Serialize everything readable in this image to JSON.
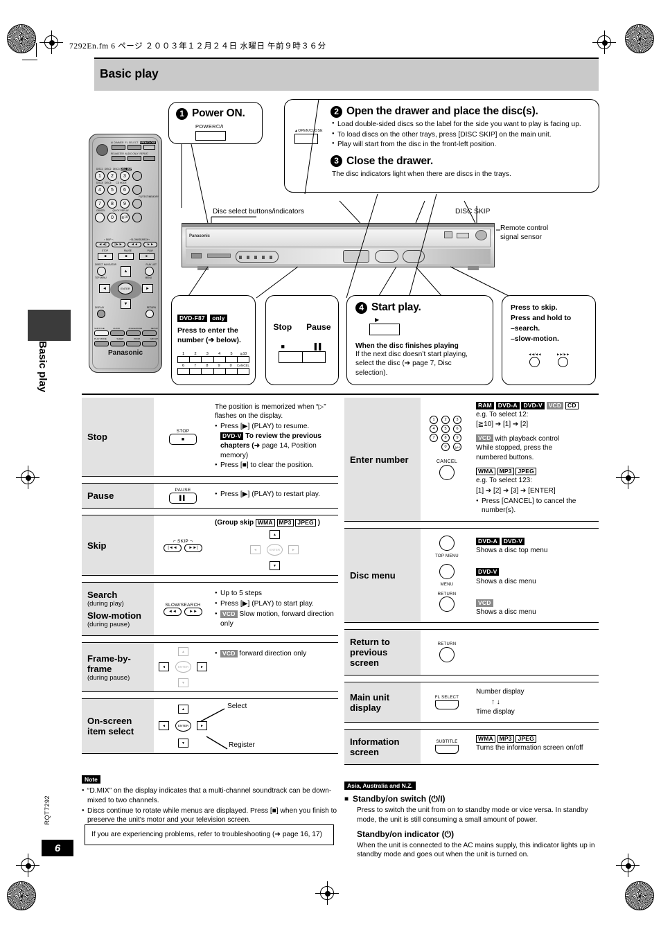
{
  "meta": {
    "fm_header": "7292En.fm  6 ページ  ２００３年１２月２４日  水曜日  午前９時３６分",
    "page_number": "6",
    "doc_code": "RQT7292",
    "spine_label": "Basic play"
  },
  "title": "Basic play",
  "steps": {
    "step1": {
      "num": "1",
      "heading": "Power ON.",
      "button_caption": "POWER⏻/I"
    },
    "step2": {
      "num": "2",
      "heading": "Open the drawer and place the disc(s).",
      "button_caption": "▲OPEN/CLOSE",
      "bullets": [
        "Load double-sided discs so the label for the side you want to play is facing up.",
        "To load discs on the other trays, press [DISC SKIP] on the main unit.",
        "Play will start from the disc in the front-left position."
      ]
    },
    "step3": {
      "num": "3",
      "heading": "Close the drawer.",
      "text": "The disc indicators light when there are discs in the trays."
    },
    "step4": {
      "num": "4",
      "heading": "Start play.",
      "play_glyph": "▶",
      "subheading": "When the disc finishes playing",
      "text": "If the next disc doesn’t start playing, select the disc (➔ page 7, Disc selection)."
    }
  },
  "unit_labels": {
    "disc_select": "Disc select buttons/indicators",
    "disc_skip": "DISC SKIP",
    "remote_sensor": "Remote control\nsignal sensor",
    "brand": "Panasonic"
  },
  "callouts": {
    "numpad": {
      "badge": "DVD-F87",
      "badge_suffix": "only",
      "line1": "Press to enter the",
      "line2": "number (➔ below).",
      "keys_top": [
        "1",
        "2",
        "3",
        "4",
        "5",
        "≧10"
      ],
      "keys_bottom": [
        "6",
        "7",
        "8",
        "9",
        "0",
        "CANCEL"
      ]
    },
    "stoppause": {
      "stop": "Stop",
      "pause": "Pause"
    },
    "skipsearch": {
      "line1": "Press to skip.",
      "line2": "Press and hold to",
      "line3": "–search.",
      "line4": "–slow-motion."
    }
  },
  "remote": {
    "brand": "Panasonic",
    "row_top": [
      "AI DIMMER",
      "FL SELECT",
      "OPEN/CLOSE"
    ],
    "row_top2": [
      "RE-MASTER",
      "AUDIO ONLY",
      "REPEAT"
    ],
    "disc_labels": [
      "DISC1",
      "DISC2",
      "DISC3",
      "DISC4",
      "DISC5",
      "DISC SKIP",
      "CD MODE",
      "FQ/TEXT/MEMORY",
      "QUICK REPLAY"
    ],
    "numbers": [
      "1",
      "2",
      "3",
      "4",
      "5",
      "6",
      "7",
      "8",
      "9",
      "0"
    ],
    "cancel": "CANCEL",
    "ge10": "≧10",
    "skip": "SKIP",
    "slowsearch": "SLOW/SEARCH",
    "transport": [
      "STOP",
      "PAUSE",
      "PLAY"
    ],
    "nav": [
      "DIRECT NAVIGATOR",
      "PLAY LIST",
      "TOP MENU",
      "MENU",
      "ENTER",
      "DISPLAY",
      "RETURN"
    ],
    "bottom_rows": [
      [
        "SUBTITLE",
        "AUDIO",
        "ANGLE/PAGE",
        "SETUP"
      ],
      [
        "PLAY MODE",
        "SLEEP",
        "ZOOM",
        "GROUP"
      ]
    ]
  },
  "left_table": [
    {
      "label": "Stop",
      "sub": "",
      "key_caption": "STOP",
      "key_glyph": "■",
      "key_type": "rect",
      "desc_html": "The position is memorized when “▷” flashes on the display.",
      "bullets": [
        "Press [▶] (PLAY) to resume. <b>DVD-V</b> <b>To review the previous chapters (➔ page 14, Position memory)</b>",
        "Press [■] to clear the position."
      ]
    },
    {
      "label": "Pause",
      "sub": "",
      "key_caption": "PAUSE",
      "key_glyph": "▐▐",
      "key_type": "rect",
      "desc_html": "",
      "bullets": [
        "Press [▶] (PLAY) to restart play."
      ]
    },
    {
      "label": "Skip",
      "sub": "",
      "key_caption": "SKIP",
      "key_glyph": "",
      "key_type": "skippair",
      "desc_html": "(Group skip WMA MP3 JPEG )",
      "bullets": []
    },
    {
      "label": "Search",
      "sub": "(during play)",
      "label2": "Slow-motion",
      "sub2": "(during pause)",
      "key_caption": "SLOW/SEARCH",
      "key_glyph": "",
      "key_type": "searchpair",
      "desc_html": "",
      "bullets": [
        "Up to 5 steps",
        "Press [▶] (PLAY) to start play.",
        "VCD Slow motion, forward direction only"
      ]
    },
    {
      "label": "Frame-by-frame",
      "sub": "(during pause)",
      "key_caption": "",
      "key_glyph": "",
      "key_type": "dpad-lr",
      "desc_html": "",
      "bullets": [
        "VCD forward direction only"
      ]
    },
    {
      "label": "On-screen item select",
      "sub": "",
      "key_caption": "",
      "key_glyph": "",
      "key_type": "dpad-full",
      "desc_html": "",
      "annotations": {
        "select": "Select",
        "register": "Register"
      },
      "bullets": []
    }
  ],
  "right_table": [
    {
      "label": "Enter number",
      "key_type": "numpad-cancel",
      "cancel_caption": "CANCEL",
      "blocks": [
        {
          "badges": [
            {
              "t": "RAM",
              "s": "solid"
            },
            {
              "t": "DVD-A",
              "s": "solid"
            },
            {
              "t": "DVD-V",
              "s": "solid"
            },
            {
              "t": "VCD",
              "s": "gray"
            },
            {
              "t": "CD",
              "s": "open"
            }
          ],
          "lines": [
            "e.g. To select 12:",
            "[≧10] ➔ [1] ➔ [2]"
          ]
        },
        {
          "badges": [
            {
              "t": "VCD",
              "s": "gray"
            }
          ],
          "inline_after_badge": "with playback control",
          "lines": [
            "While stopped, press the",
            "numbered buttons."
          ]
        },
        {
          "badges": [
            {
              "t": "WMA",
              "s": "open"
            },
            {
              "t": "MP3",
              "s": "open"
            },
            {
              "t": "JPEG",
              "s": "open"
            }
          ],
          "lines": [
            "e.g. To select 123:",
            "[1] ➔ [2] ➔ [3] ➔ [ENTER]"
          ],
          "bullets": [
            "Press [CANCEL] to cancel the number(s)."
          ]
        }
      ]
    },
    {
      "label": "Disc menu",
      "key_type": "three-round",
      "rows": [
        {
          "caption": "TOP MENU",
          "caption_pos": "below",
          "badges": [
            {
              "t": "DVD-A",
              "s": "solid"
            },
            {
              "t": "DVD-V",
              "s": "solid"
            }
          ],
          "text": "Shows a disc top menu"
        },
        {
          "caption": "MENU",
          "caption_pos": "below",
          "badges": [
            {
              "t": "DVD-V",
              "s": "solid"
            }
          ],
          "text": "Shows a disc menu"
        },
        {
          "caption": "RETURN",
          "caption_pos": "above",
          "badges": [
            {
              "t": "VCD",
              "s": "gray"
            }
          ],
          "text": "Shows a disc menu"
        }
      ]
    },
    {
      "label": "Return to previous screen",
      "key_type": "round",
      "key_caption": "RETURN",
      "text": ""
    },
    {
      "label": "Main unit display",
      "key_type": "rect",
      "key_caption": "FL SELECT",
      "lines": [
        "Number display",
        "↑ ↓",
        "Time display"
      ]
    },
    {
      "label": "Information screen",
      "key_type": "rect",
      "key_caption": "SUBTITLE",
      "badges": [
        {
          "t": "WMA",
          "s": "open"
        },
        {
          "t": "MP3",
          "s": "open"
        },
        {
          "t": "JPEG",
          "s": "open"
        }
      ],
      "text": "Turns the information screen on/off"
    }
  ],
  "note": {
    "tag": "Note",
    "items": [
      "“D.MIX” on the display indicates that a multi-channel soundtrack can be down-mixed to two channels.",
      "Discs continue to rotate while menus are displayed. Press [■] when you finish to preserve the unit's motor and your television screen."
    ]
  },
  "troubleshoot": "If you are experiencing problems, refer to troubleshooting (➔ page 16, 17)",
  "standby": {
    "region_tag": "Asia, Australia and N.Z.",
    "switch_heading": "Standby/on switch (⏻/I)",
    "switch_text": "Press to switch the unit from on to standby mode or vice versa. In standby mode, the unit is still consuming a small amount of power.",
    "indicator_heading": "Standby/on indicator (⏻)",
    "indicator_text": "When the unit is connected to the AC mains supply, this indicator lights up in standby mode and goes out when the unit is turned on."
  }
}
